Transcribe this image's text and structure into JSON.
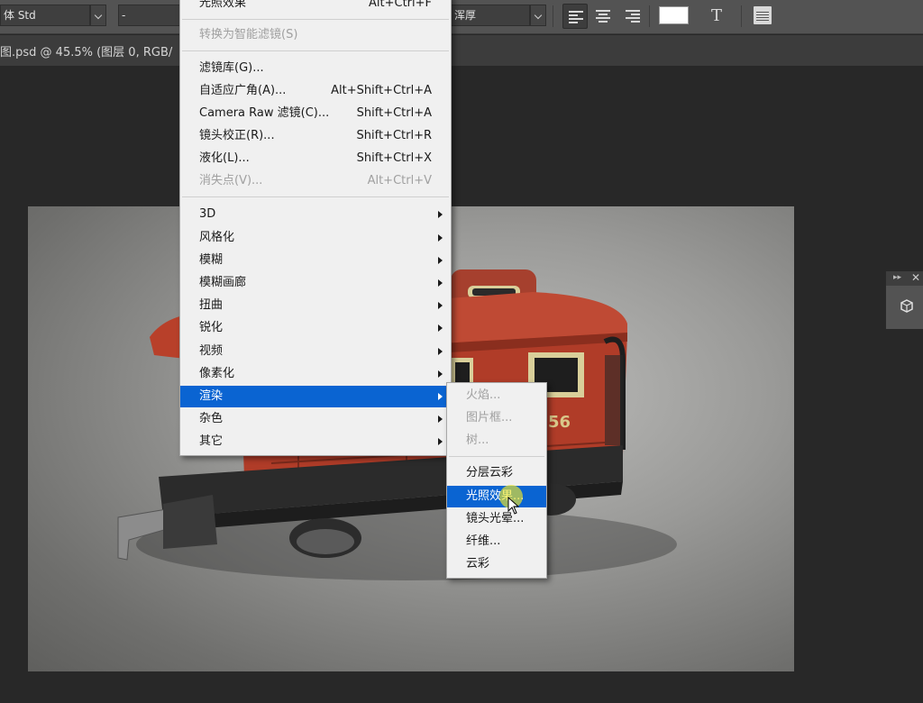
{
  "options_bar": {
    "font_family": "体 Std",
    "font_style": "-",
    "antialias": "浑厚"
  },
  "document": {
    "tab_title": "图.psd @ 45.5% (图层 0, RGB/"
  },
  "filter_menu": {
    "top_item": {
      "label": "光照效果",
      "shortcut": "Alt+Ctrl+F"
    },
    "smart_filter": {
      "label": "转换为智能滤镜(S)"
    },
    "items_a": [
      {
        "label": "滤镜库(G)...",
        "shortcut": ""
      },
      {
        "label": "自适应广角(A)...",
        "shortcut": "Alt+Shift+Ctrl+A"
      },
      {
        "label": "Camera Raw 滤镜(C)...",
        "shortcut": "Shift+Ctrl+A"
      },
      {
        "label": "镜头校正(R)...",
        "shortcut": "Shift+Ctrl+R"
      },
      {
        "label": "液化(L)...",
        "shortcut": "Shift+Ctrl+X"
      },
      {
        "label": "消失点(V)...",
        "shortcut": "Alt+Ctrl+V"
      }
    ],
    "submenus": [
      {
        "label": "3D"
      },
      {
        "label": "风格化"
      },
      {
        "label": "模糊"
      },
      {
        "label": "模糊画廊"
      },
      {
        "label": "扭曲"
      },
      {
        "label": "锐化"
      },
      {
        "label": "视频"
      },
      {
        "label": "像素化"
      },
      {
        "label": "渲染"
      },
      {
        "label": "杂色"
      },
      {
        "label": "其它"
      }
    ],
    "highlighted": "渲染"
  },
  "render_submenu": {
    "items_disabled": [
      {
        "label": "火焰..."
      },
      {
        "label": "图片框..."
      },
      {
        "label": "树..."
      }
    ],
    "items": [
      {
        "label": "分层云彩"
      },
      {
        "label": "光照效果..."
      },
      {
        "label": "镜头光晕..."
      },
      {
        "label": "纤维..."
      },
      {
        "label": "云彩"
      }
    ],
    "highlighted": "光照效果..."
  },
  "canvas_image": {
    "subject": "red toy train caboose",
    "number_visible": "56"
  },
  "colors": {
    "menu_highlight": "#0a64d2",
    "menu_background": "#f0f0f0",
    "workspace": "#282828",
    "toolbar": "#535353",
    "caboose_red": "#b8402a"
  }
}
